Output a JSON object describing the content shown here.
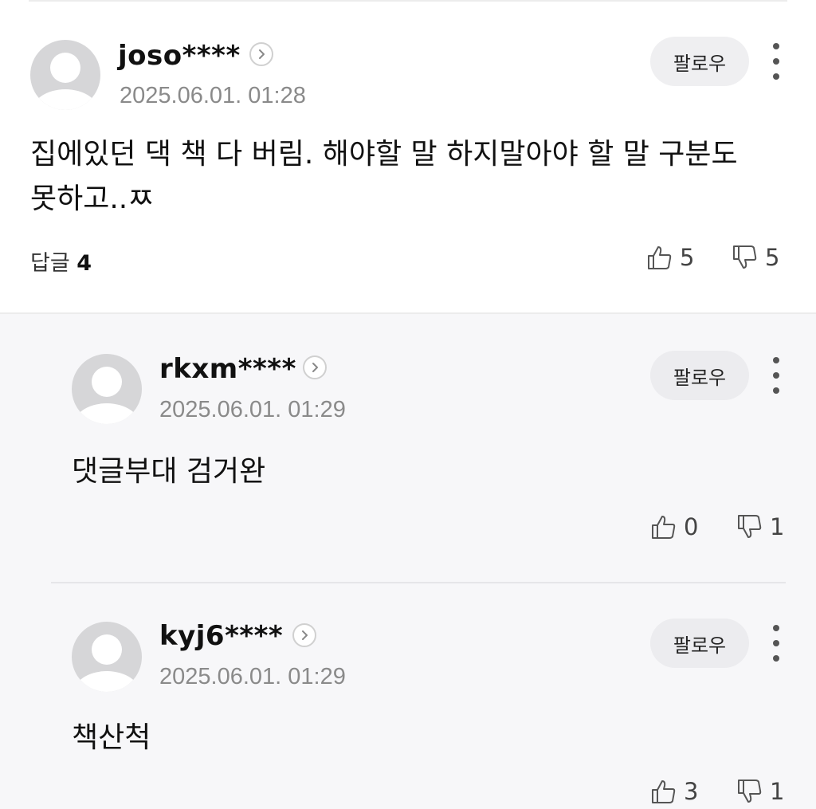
{
  "comments": [
    {
      "username": "joso****",
      "timestamp": "2025.06.01. 01:28",
      "follow_label": "팔로우",
      "text": "집에있던 댁 책 다 버림. 해야할 말 하지말아야 할 말 구분도 못하고..ㅉ",
      "reply_label": "답글",
      "reply_count": "4",
      "likes": "5",
      "dislikes": "5"
    }
  ],
  "replies": [
    {
      "username": "rkxm****",
      "timestamp": "2025.06.01. 01:29",
      "follow_label": "팔로우",
      "text": "댓글부대 검거완",
      "likes": "0",
      "dislikes": "1"
    },
    {
      "username": "kyj6****",
      "timestamp": "2025.06.01. 01:29",
      "follow_label": "팔로우",
      "text": "책산척",
      "likes": "3",
      "dislikes": "1"
    }
  ],
  "icons": {
    "avatar": "default-avatar-icon",
    "profile_chevron": "chevron-right-icon",
    "more": "more-vertical-icon",
    "like": "thumbs-up-icon",
    "dislike": "thumbs-down-icon"
  },
  "colors": {
    "follow_bg": "#efeff1",
    "reply_section_bg": "#f7f7f9",
    "timestamp": "#8a8a8a"
  }
}
